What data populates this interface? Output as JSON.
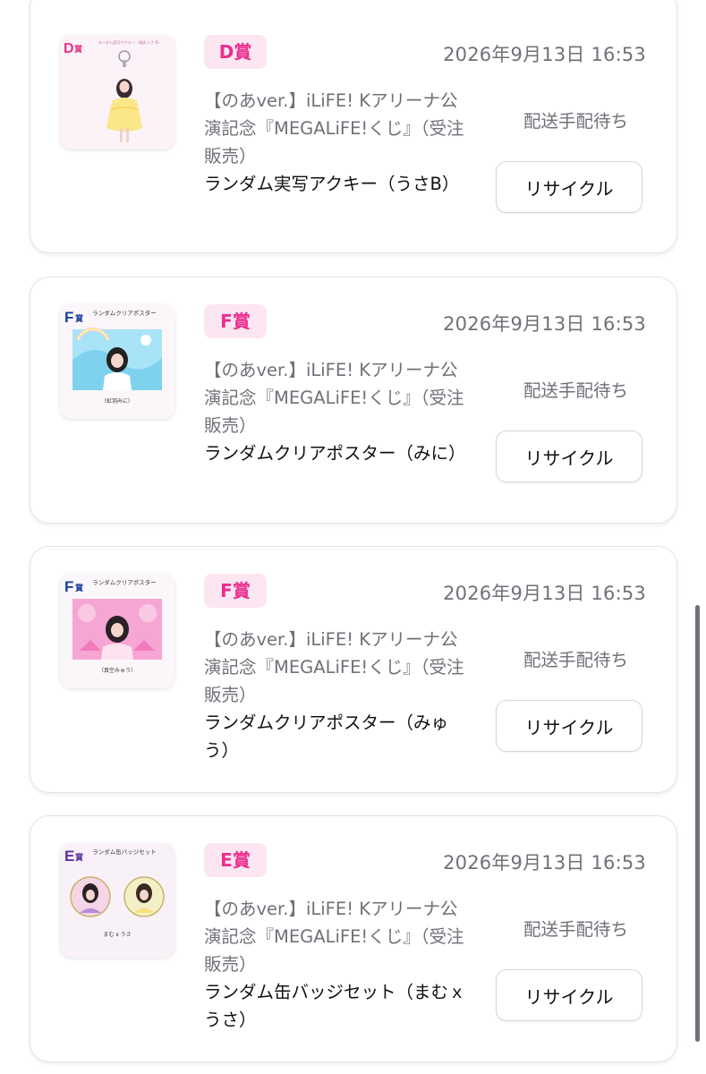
{
  "colors": {
    "badge_bg": "#fbe6f2",
    "badge_text": "#ec2e8d",
    "muted_text": "#707078",
    "card_border": "#e3e3e8"
  },
  "items": [
    {
      "prize": "D賞",
      "date": "2026年9月13日 16:53",
      "description": "【のあver.】iLiFE! Kアリーナ公演記念『MEGALiFE!くじ』（受注販売）",
      "name": "ランダム実写アクキー（うさB）",
      "status": "配送手配待ち",
      "button": "リサイクル",
      "thumbnail": {
        "icon": "acrylic-keychain-image",
        "letter": "D",
        "letter_suffix": "賞",
        "caption": "ランダム実写アクキー（福丸うさ B）"
      }
    },
    {
      "prize": "F賞",
      "date": "2026年9月13日 16:53",
      "description": "【のあver.】iLiFE! Kアリーナ公演記念『MEGALiFE!くじ』（受注販売）",
      "name": "ランダムクリアポスター（みに）",
      "status": "配送手配待ち",
      "button": "リサイクル",
      "thumbnail": {
        "icon": "clear-poster-image",
        "letter": "F",
        "letter_suffix": "賞",
        "caption": "ランダムクリアポスター",
        "sub": "（虹羽みに）"
      }
    },
    {
      "prize": "F賞",
      "date": "2026年9月13日 16:53",
      "description": "【のあver.】iLiFE! Kアリーナ公演記念『MEGALiFE!くじ』（受注販売）",
      "name": "ランダムクリアポスター（みゅう）",
      "status": "配送手配待ち",
      "button": "リサイクル",
      "thumbnail": {
        "icon": "clear-poster-image",
        "letter": "F",
        "letter_suffix": "賞",
        "caption": "ランダムクリアポスター",
        "sub": "（真空みゅう）"
      }
    },
    {
      "prize": "E賞",
      "date": "2026年9月13日 16:53",
      "description": "【のあver.】iLiFE! Kアリーナ公演記念『MEGALiFE!くじ』（受注販売）",
      "name": "ランダム缶バッジセット（まむｘうさ）",
      "status": "配送手配待ち",
      "button": "リサイクル",
      "thumbnail": {
        "icon": "badge-set-image",
        "letter": "E",
        "letter_suffix": "賞",
        "caption": "ランダム缶バッジセット",
        "sub": "まむ x うさ"
      }
    }
  ]
}
